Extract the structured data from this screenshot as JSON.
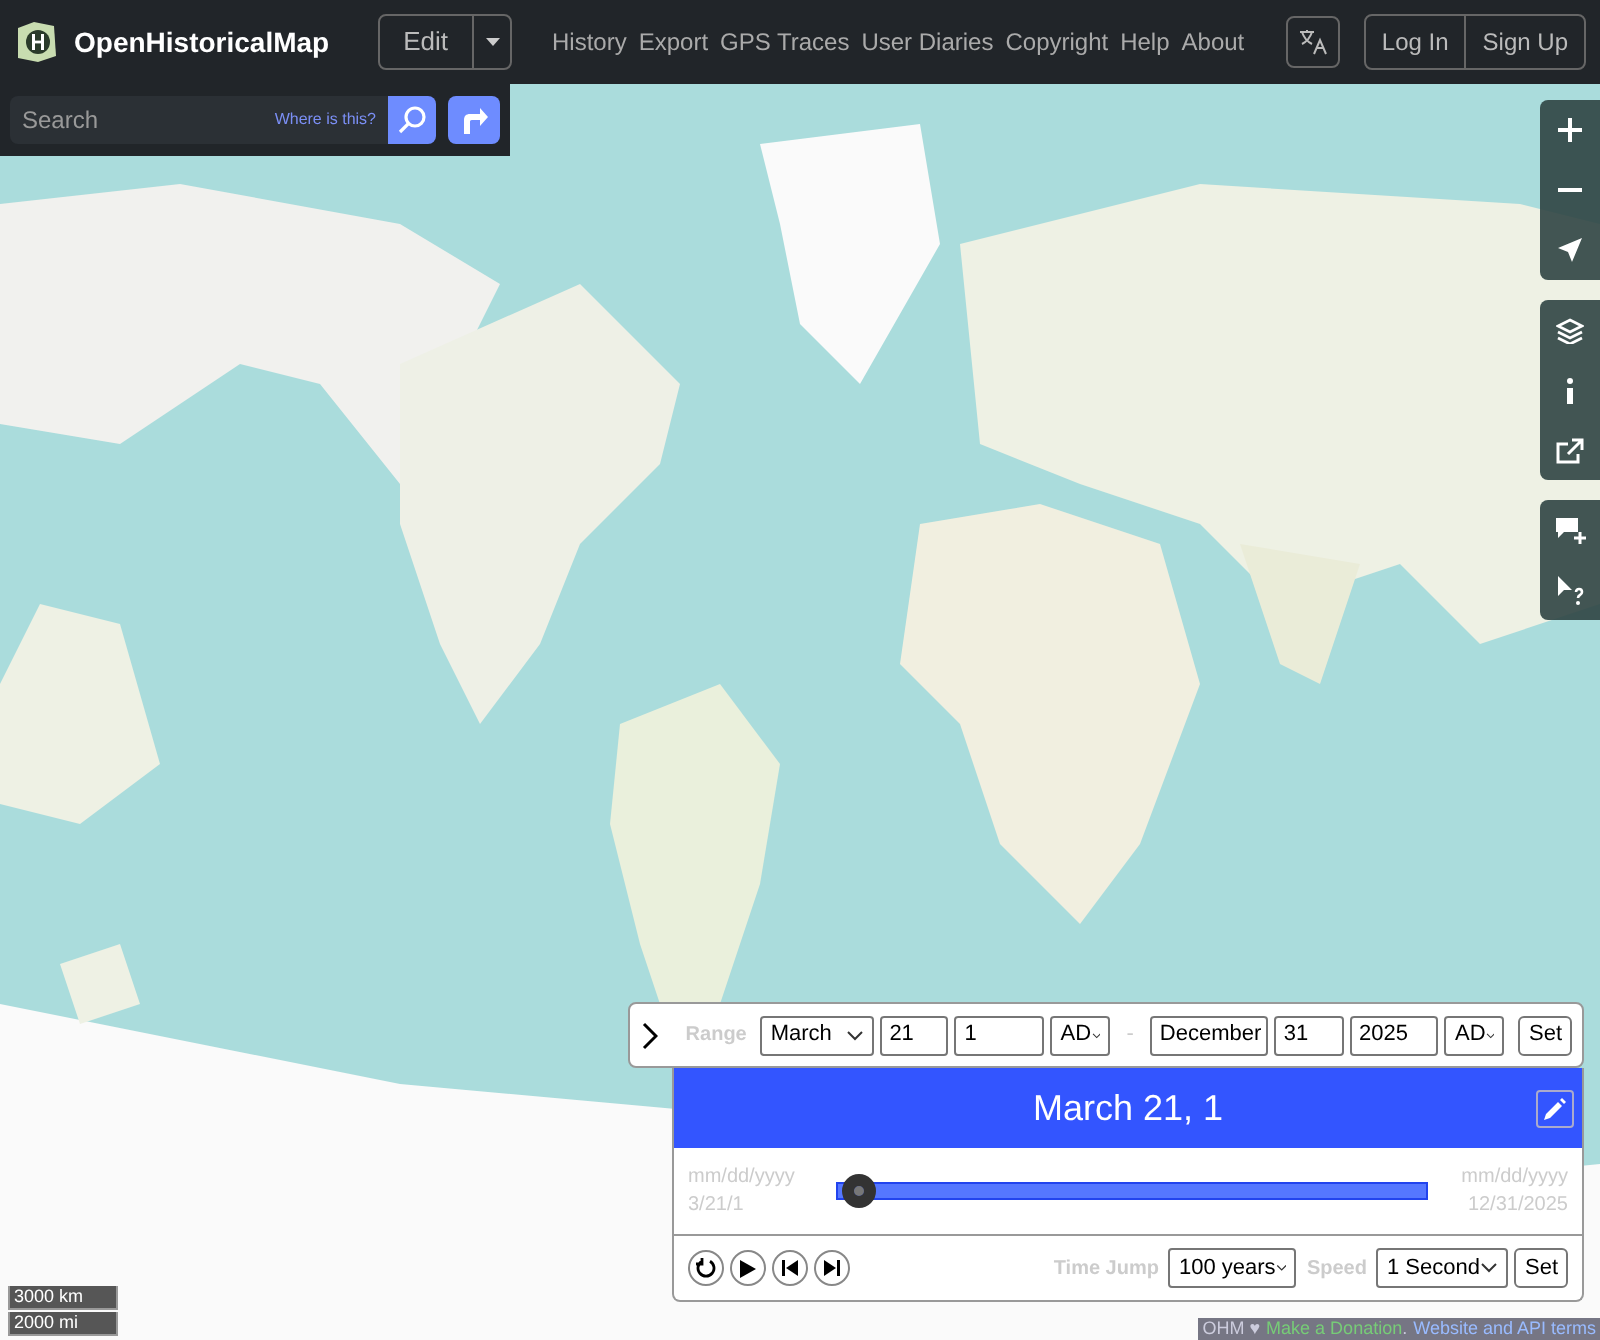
{
  "header": {
    "brand": "OpenHistoricalMap",
    "edit": "Edit",
    "nav": [
      "History",
      "Export",
      "GPS Traces",
      "User Diaries",
      "Copyright",
      "Help",
      "About"
    ],
    "account": [
      "Log In",
      "Sign Up"
    ]
  },
  "search": {
    "placeholder": "Search",
    "hint": "Where is this?"
  },
  "time_panel": {
    "range_label": "Range",
    "start": {
      "month": "March",
      "day": "21",
      "year": "1",
      "era": "AD"
    },
    "separator": "-",
    "end": {
      "month": "December",
      "day": "31",
      "year": "2025",
      "era": "AD"
    },
    "range_set": "Set",
    "current_date": "March 21, 1",
    "start_format": "mm/dd/yyyy",
    "start_value": "3/21/1",
    "end_format": "mm/dd/yyyy",
    "end_value": "12/31/2025",
    "slider": {
      "level": 0.01
    },
    "time_jump_label": "Time Jump",
    "time_jump": "100 years",
    "speed_label": "Speed",
    "speed": "1 Second",
    "set": "Set"
  },
  "scale": [
    "3000 km",
    "2000 mi"
  ],
  "attribution": {
    "prefix": "OHM ♥",
    "donate": "Make a Donation",
    "sep": ".",
    "terms": "Website and API terms"
  }
}
